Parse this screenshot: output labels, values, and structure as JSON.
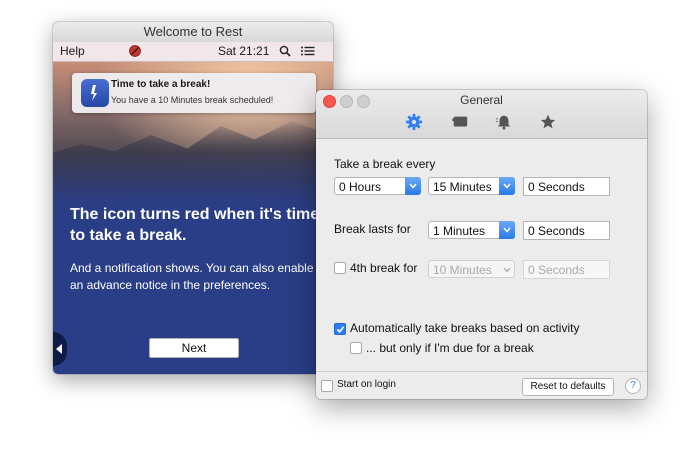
{
  "welcome_window": {
    "title": "Welcome to Rest",
    "menubar": {
      "help_label": "Help",
      "clock": "Sat 21:21",
      "icons": [
        "stop-icon",
        "search-icon",
        "list-icon"
      ]
    },
    "notification": {
      "title": "Time to take a break!",
      "message": "You have a 10 Minutes break scheduled!",
      "icon": "rest-app-icon"
    },
    "headline": "The icon turns red when it's time to take a break.",
    "body": "And a notification shows. You can also enable an advance notice in the preferences.",
    "next_label": "Next",
    "colors": {
      "panel": "#2a3e87",
      "stop_icon": "#c0392b"
    }
  },
  "general_window": {
    "title": "General",
    "toolbar_icons": [
      "gear-icon",
      "display-icon",
      "bell-icon",
      "star-icon"
    ],
    "selected_tab": "gear-icon",
    "take_break_every_label": "Take a break every",
    "hours_value": "0 Hours",
    "minutes_value": "15 Minutes",
    "seconds_value": "0 Seconds",
    "break_lasts_label": "Break lasts for",
    "break_minutes_value": "1 Minutes",
    "break_seconds_value": "0 Seconds",
    "fourth_break_label": "4th break for",
    "fourth_break_checked": false,
    "fourth_minutes_value": "10 Minutes",
    "fourth_seconds_value": "0 Seconds",
    "auto_breaks_label": "Automatically take breaks based on activity",
    "auto_breaks_checked": true,
    "only_if_due_label": "... but only if I'm due for a break",
    "only_if_due_checked": false,
    "start_on_login_label": "Start on login",
    "start_on_login_checked": false,
    "reset_label": "Reset to defaults",
    "help_label": "?",
    "colors": {
      "accent": "#2f7ff2",
      "close": "#fc5753"
    }
  }
}
